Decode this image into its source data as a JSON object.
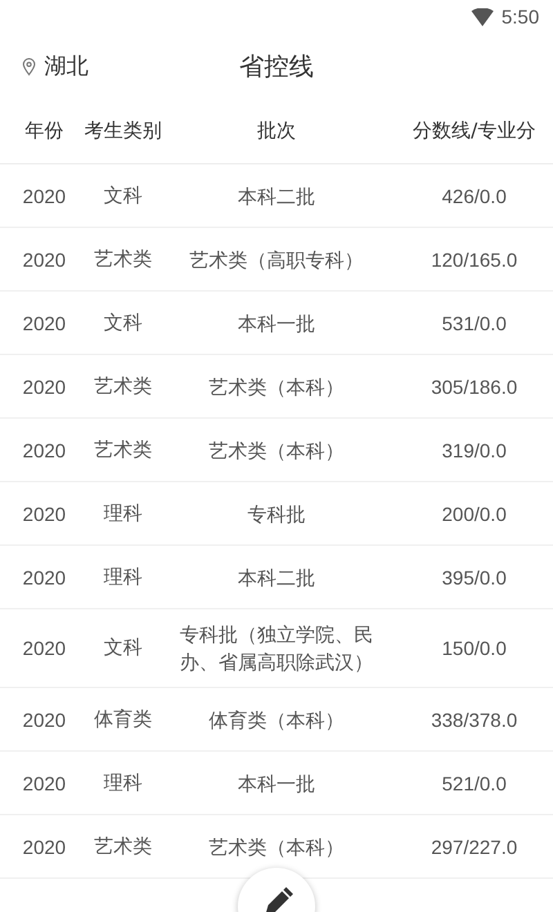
{
  "status_bar": {
    "time": "5:50"
  },
  "header": {
    "location": "湖北",
    "title": "省控线"
  },
  "table": {
    "columns": [
      "年份",
      "考生类别",
      "批次",
      "分数线/专业分"
    ],
    "rows": [
      [
        "2020",
        "文科",
        "本科二批",
        "426/0.0"
      ],
      [
        "2020",
        "艺术类",
        "艺术类（高职专科）",
        "120/165.0"
      ],
      [
        "2020",
        "文科",
        "本科一批",
        "531/0.0"
      ],
      [
        "2020",
        "艺术类",
        "艺术类（本科）",
        "305/186.0"
      ],
      [
        "2020",
        "艺术类",
        "艺术类（本科）",
        "319/0.0"
      ],
      [
        "2020",
        "理科",
        "专科批",
        "200/0.0"
      ],
      [
        "2020",
        "理科",
        "本科二批",
        "395/0.0"
      ],
      [
        "2020",
        "文科",
        "专科批（独立学院、民办、省属高职除武汉）",
        "150/0.0"
      ],
      [
        "2020",
        "体育类",
        "体育类（本科）",
        "338/378.0"
      ],
      [
        "2020",
        "理科",
        "本科一批",
        "521/0.0"
      ],
      [
        "2020",
        "艺术类",
        "艺术类（本科）",
        "297/227.0"
      ]
    ]
  }
}
